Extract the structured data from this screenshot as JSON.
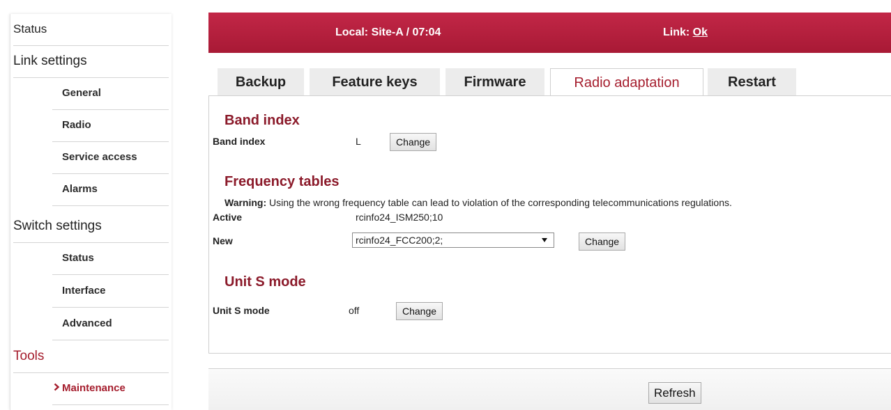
{
  "sidebar": {
    "items": [
      {
        "label": "Status",
        "kind": "section"
      },
      {
        "label": "Link settings",
        "kind": "section"
      },
      {
        "label": "General",
        "kind": "sub"
      },
      {
        "label": "Radio",
        "kind": "sub"
      },
      {
        "label": "Service access",
        "kind": "sub"
      },
      {
        "label": "Alarms",
        "kind": "sub"
      },
      {
        "label": "Switch settings",
        "kind": "section"
      },
      {
        "label": "Status",
        "kind": "sub"
      },
      {
        "label": "Interface",
        "kind": "sub"
      },
      {
        "label": "Advanced",
        "kind": "sub"
      },
      {
        "label": "Tools",
        "kind": "section"
      },
      {
        "label": "Maintenance",
        "kind": "sub",
        "active": true
      }
    ],
    "active_arrow": "›"
  },
  "header": {
    "local": "Local: Site-A / 07:04",
    "link_label": "Link: ",
    "link_value": "Ok"
  },
  "tabs": [
    {
      "label": "Backup"
    },
    {
      "label": "Feature keys"
    },
    {
      "label": "Firmware"
    },
    {
      "label": "Radio adaptation",
      "active": true
    },
    {
      "label": "Restart"
    }
  ],
  "band_index": {
    "heading": "Band index",
    "label": "Band index",
    "value": "L",
    "button": "Change"
  },
  "frequency_tables": {
    "heading": "Frequency tables",
    "warning_prefix": "Warning:",
    "warning_text": " Using the wrong frequency table can lead to violation of the corresponding telecommunications regulations.",
    "active_label": "Active",
    "active_value": "rcinfo24_ISM250;10",
    "new_label": "New",
    "new_value": "rcinfo24_FCC200;2;",
    "button": "Change"
  },
  "unit_s_mode": {
    "heading": "Unit S mode",
    "label": "Unit S mode",
    "value": "off",
    "button": "Change"
  },
  "footer": {
    "refresh": "Refresh"
  },
  "colors": {
    "brand": "#b31c3a",
    "heading": "#8b1a2a",
    "accent": "#a51d2d"
  }
}
